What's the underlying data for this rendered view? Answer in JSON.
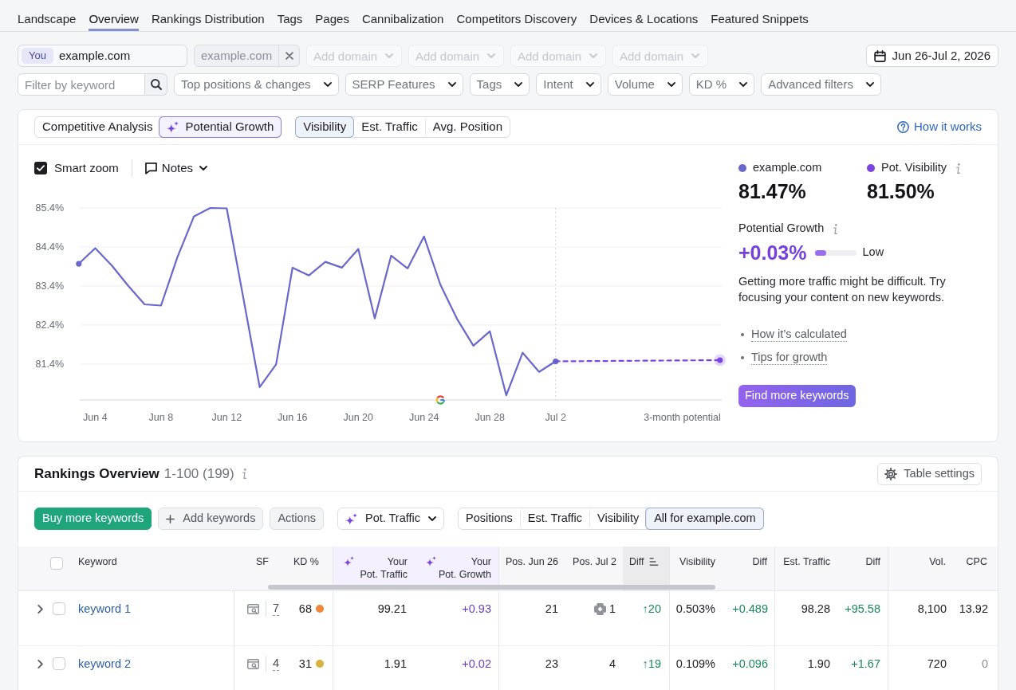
{
  "nav_tabs": [
    {
      "label": "Landscape",
      "selected": false
    },
    {
      "label": "Overview",
      "selected": true
    },
    {
      "label": "Rankings Distribution",
      "selected": false
    },
    {
      "label": "Tags",
      "selected": false
    },
    {
      "label": "Pages",
      "selected": false
    },
    {
      "label": "Cannibalization",
      "selected": false
    },
    {
      "label": "Competitors Discovery",
      "selected": false
    },
    {
      "label": "Devices & Locations",
      "selected": false
    },
    {
      "label": "Featured Snippets",
      "selected": false
    }
  ],
  "domains": {
    "own": {
      "badge": "You",
      "value": "example.com"
    },
    "competitors": [
      {
        "value": "example.com"
      }
    ],
    "add_fields": [
      {
        "placeholder": "Add domain",
        "disabled": true
      },
      {
        "placeholder": "Add domain",
        "disabled": true
      },
      {
        "placeholder": "Add domain",
        "disabled": true
      },
      {
        "placeholder": "Add domain",
        "disabled": true
      }
    ]
  },
  "date_range": "Jun 26-Jul 2, 2026",
  "filters": {
    "search": {
      "placeholder": "Filter by keyword"
    },
    "dropdowns": [
      "Top positions & changes",
      "SERP Features",
      "Tags",
      "Intent",
      "Volume",
      "KD %",
      "Advanced filters"
    ]
  },
  "overview_card": {
    "mode_tabs": [
      {
        "label": "Competitive Analysis",
        "selected": false,
        "kind": "plain"
      },
      {
        "label": "Potential Growth",
        "selected": true,
        "kind": "ai"
      }
    ],
    "metric_tabs": [
      {
        "label": "Visibility",
        "selected": true
      },
      {
        "label": "Est. Traffic",
        "selected": false
      },
      {
        "label": "Avg. Position",
        "selected": false
      }
    ],
    "help_link": "How it works",
    "smart_zoom": {
      "label": "Smart zoom",
      "checked": true
    },
    "notes": "Notes",
    "chart_data": {
      "type": "line",
      "categories": [
        null,
        "Jun 4",
        null,
        null,
        null,
        "Jun 8",
        null,
        null,
        null,
        "Jun 12",
        null,
        null,
        null,
        "Jun 16",
        null,
        null,
        null,
        "Jun 20",
        null,
        null,
        null,
        "Jun 24",
        null,
        null,
        null,
        "Jun 28",
        null,
        null,
        null,
        "Jul 2",
        null,
        null,
        null,
        null,
        null,
        null,
        null,
        null,
        null,
        null
      ],
      "series": [
        {
          "name": "example.com",
          "color": "#6868cc",
          "values": [
            83.97,
            84.37,
            83.93,
            83.41,
            82.93,
            82.9,
            84.14,
            85.18,
            85.4,
            85.39,
            83.11,
            80.81,
            81.39,
            83.87,
            83.67,
            84.02,
            83.87,
            84.35,
            82.57,
            84.18,
            83.85,
            84.67,
            83.43,
            82.56,
            81.87,
            82.24,
            80.6,
            81.69,
            81.2,
            81.47,
            null,
            null,
            null,
            null,
            null,
            null,
            null,
            null,
            null,
            null
          ]
        },
        {
          "name": "Pot. Visibility",
          "color": "#7b45e0",
          "line_style": "dashed",
          "values": [
            null,
            null,
            null,
            null,
            null,
            null,
            null,
            null,
            null,
            null,
            null,
            null,
            null,
            null,
            null,
            null,
            null,
            null,
            null,
            null,
            null,
            null,
            null,
            null,
            null,
            null,
            null,
            null,
            null,
            81.47,
            null,
            null,
            null,
            null,
            null,
            null,
            null,
            null,
            null,
            81.5
          ]
        }
      ],
      "ylim": [
        80.48,
        85.4
      ],
      "yticks": [
        {
          "value": 85.4,
          "label": "85.4%"
        },
        {
          "value": 84.4,
          "label": "84.4%"
        },
        {
          "value": 83.4,
          "label": "83.4%"
        },
        {
          "value": 82.4,
          "label": "82.4%"
        },
        {
          "value": 81.4,
          "label": "81.4%"
        }
      ],
      "grid": true,
      "annotations": [
        "3-month potential"
      ]
    },
    "legend_values": [
      {
        "value": "81.47%",
        "info": false
      },
      {
        "value": "81.50%",
        "info": true
      }
    ],
    "growth": {
      "label": "Potential Growth",
      "value": "+0.03%",
      "level": 0.28,
      "rating": "Low"
    },
    "message": "Getting more traffic might be difficult. Try focusing your content on new keywords.",
    "links": [
      "How it’s calculated",
      "Tips for growth"
    ],
    "cta": "Find more keywords"
  },
  "rankings": {
    "title": "Rankings Overview",
    "range": "1-100 (199)",
    "settings_button": "Table settings",
    "actions": [
      {
        "label": "Buy more keywords",
        "kind": "primary"
      },
      {
        "label": "Add keywords",
        "kind": "add"
      },
      {
        "label": "Actions",
        "kind": "secondary"
      }
    ],
    "metric_select": "Pot. Traffic",
    "view_tabs": [
      {
        "label": "Positions",
        "selected": false
      },
      {
        "label": "Est. Traffic",
        "selected": false
      },
      {
        "label": "Visibility",
        "selected": false
      },
      {
        "label": "All for example.com",
        "selected": true
      }
    ],
    "select_all_checked": false,
    "columns": [
      {
        "label": "Keyword",
        "kind": "plain"
      },
      {
        "label": "SF",
        "kind": "plain"
      },
      {
        "label": "KD %",
        "kind": "plain"
      },
      {
        "label": "Your\nPot. Traffic",
        "kind": "ai"
      },
      {
        "label": "Your\nPot. Growth",
        "kind": "ai"
      },
      {
        "label": "Pos. Jun 26",
        "kind": "plain"
      },
      {
        "label": "Pos. Jul 2",
        "kind": "plain"
      },
      {
        "label": "Diff",
        "kind": "sorted"
      },
      {
        "label": "Visibility",
        "kind": "plain"
      },
      {
        "label": "Diff",
        "kind": "plain"
      },
      {
        "label": "Est. Traffic",
        "kind": "plain"
      },
      {
        "label": "Diff",
        "kind": "plain"
      },
      {
        "label": "Vol.",
        "kind": "plain"
      },
      {
        "label": "CPC",
        "kind": "plain"
      }
    ],
    "rows": [
      {
        "expanded": false,
        "checked": false,
        "keyword": "keyword 1",
        "sf": "7",
        "kd": "68",
        "color": "#f0873a",
        "pot_traffic": "99.21",
        "pot_growth": "+0.93",
        "pos_jun_26": "21",
        "pos_jul_2": "1",
        "pos_jul_2_feature": true,
        "diff": "↑20",
        "visibility": "0.503%",
        "visibility_diff": "+0.489",
        "est_traffic": "98.28",
        "est_traffic_diff": "+95.58",
        "volume": "8,100",
        "cpc": "13.92",
        "cpc_dim": false
      },
      {
        "expanded": false,
        "checked": false,
        "keyword": "keyword 2",
        "sf": "4",
        "kd": "31",
        "color": "#d8b13e",
        "pot_traffic": "1.91",
        "pot_growth": "+0.02",
        "pos_jun_26": "23",
        "pos_jul_2": "4",
        "pos_jul_2_feature": false,
        "diff": "↑19",
        "visibility": "0.109%",
        "visibility_diff": "+0.096",
        "est_traffic": "1.90",
        "est_traffic_diff": "+1.67",
        "volume": "720",
        "cpc": "0",
        "cpc_dim": true
      }
    ]
  }
}
